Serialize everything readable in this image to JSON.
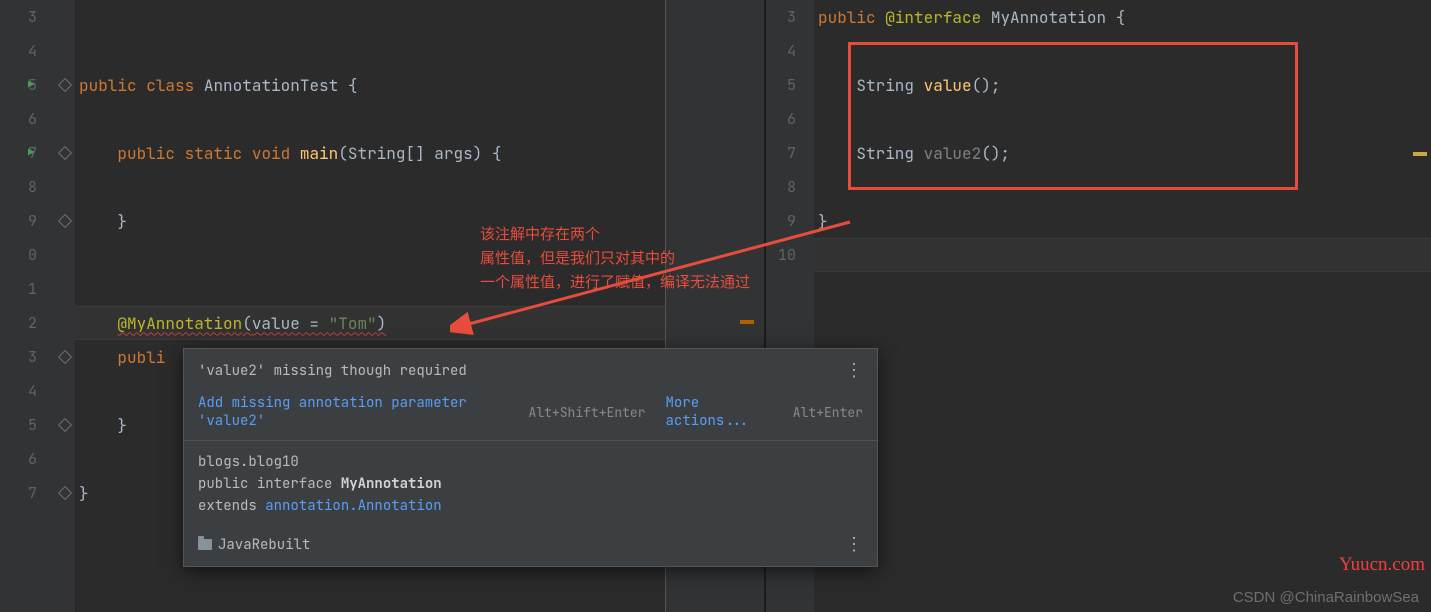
{
  "left": {
    "line_numbers": [
      "3",
      "4",
      "5",
      "6",
      "7",
      "8",
      "9",
      "0",
      "1",
      "2",
      "3",
      "4",
      "5",
      "6",
      "7"
    ],
    "code": {
      "public": "public",
      "class": "class",
      "className": "AnnotationTest",
      "static": "static",
      "void": "void",
      "main": "main",
      "mainParams": "(String[] args) {",
      "closeBrace": "}",
      "annotation": "@MyAnnotation",
      "annotationArgs_open": "(",
      "annotationArgs_value": "value = ",
      "annotationArgs_str": "\"Tom\"",
      "annotationArgs_close": ")",
      "publi": "publi"
    }
  },
  "right": {
    "line_numbers": [
      "3",
      "4",
      "5",
      "6",
      "7",
      "8",
      "9",
      "10"
    ],
    "code": {
      "public": "public",
      "atinterface": "@interface",
      "ifaceName": "MyAnnotation",
      "openBrace": "{",
      "stringType": "String",
      "value": "value",
      "value2": "value2",
      "parens": "();",
      "closeBrace": "}"
    }
  },
  "annotation_text": {
    "l1": "该注解中存在两个",
    "l2": "属性值，但是我们只对其中的",
    "l3": "一个属性值，进行了赋值，编译无法通过"
  },
  "tooltip": {
    "title": "'value2' missing though required",
    "action1": "Add missing annotation parameter 'value2'",
    "hint1": "Alt+Shift+Enter",
    "action2": "More actions...",
    "hint2": "Alt+Enter",
    "pkg": "blogs.blog10",
    "decl_public": "public",
    "decl_interface": "interface",
    "decl_name": "MyAnnotation",
    "decl_extends": "extends",
    "decl_super": "annotation.Annotation",
    "module": "JavaRebuilt"
  },
  "watermarks": {
    "csdn": "CSDN @ChinaRainbowSea",
    "yuucn": "Yuucn.com"
  }
}
